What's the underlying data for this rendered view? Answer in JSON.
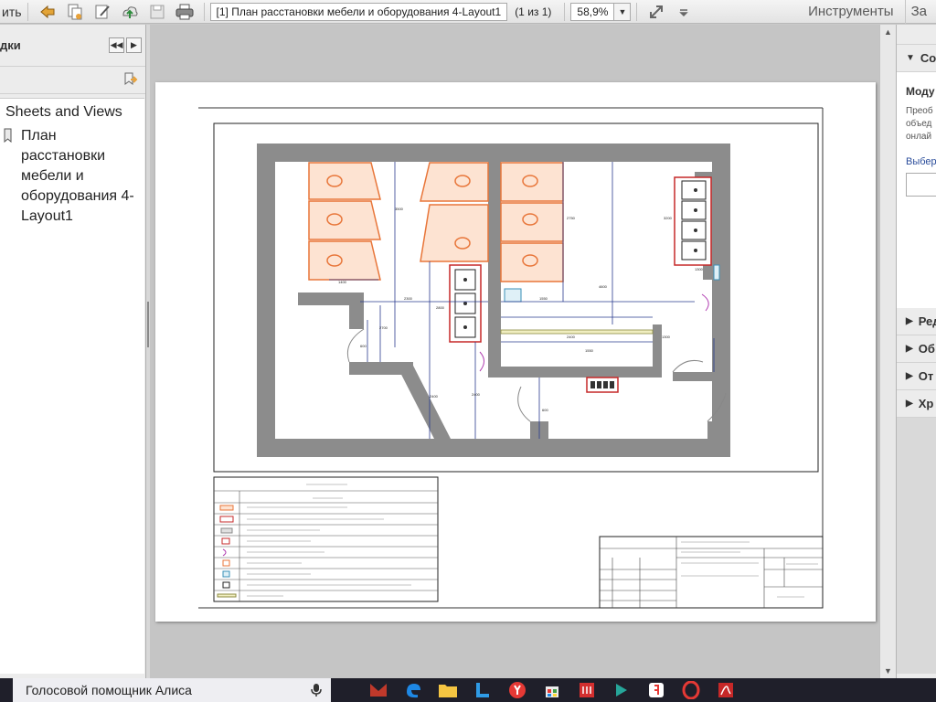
{
  "toolbar": {
    "left_text": "ить",
    "document_name": "[1] План расстановки мебели и оборудования 4-Layout1",
    "page_info": "(1 из 1)",
    "zoom": "58,9%",
    "tools_label": "Инструменты",
    "right_cut_label": "За"
  },
  "left_panel": {
    "title": "дки",
    "tree_root": "Sheets and Views",
    "tree_item": "План расстановки мебели и оборудования 4-Layout1"
  },
  "right_panel": {
    "sections": [
      {
        "label": "Со",
        "expanded": true
      },
      {
        "label": "Ред",
        "expanded": false
      },
      {
        "label": "Об",
        "expanded": false
      },
      {
        "label": "От",
        "expanded": false
      },
      {
        "label": "Хр",
        "expanded": false
      }
    ],
    "body_title": "Моду",
    "body_lines": [
      "Преоб",
      "объед",
      "онлай"
    ],
    "body_link": "Выбер"
  },
  "taskbar": {
    "search_text": "Голосовой помощник Алиса",
    "apps": [
      "mail-icon",
      "edge-icon",
      "explorer-icon",
      "store-like-icon",
      "yandex-icon",
      "bag-icon",
      "app-red-icon",
      "app-cyan-icon",
      "yandex-browser-icon",
      "opera-icon",
      "acrobat-icon"
    ]
  },
  "colors": {
    "accent_orange": "#e8763a",
    "wall_gray": "#8c8c8c",
    "line_blue": "#2a3b8f",
    "accent_red": "#c62828"
  }
}
